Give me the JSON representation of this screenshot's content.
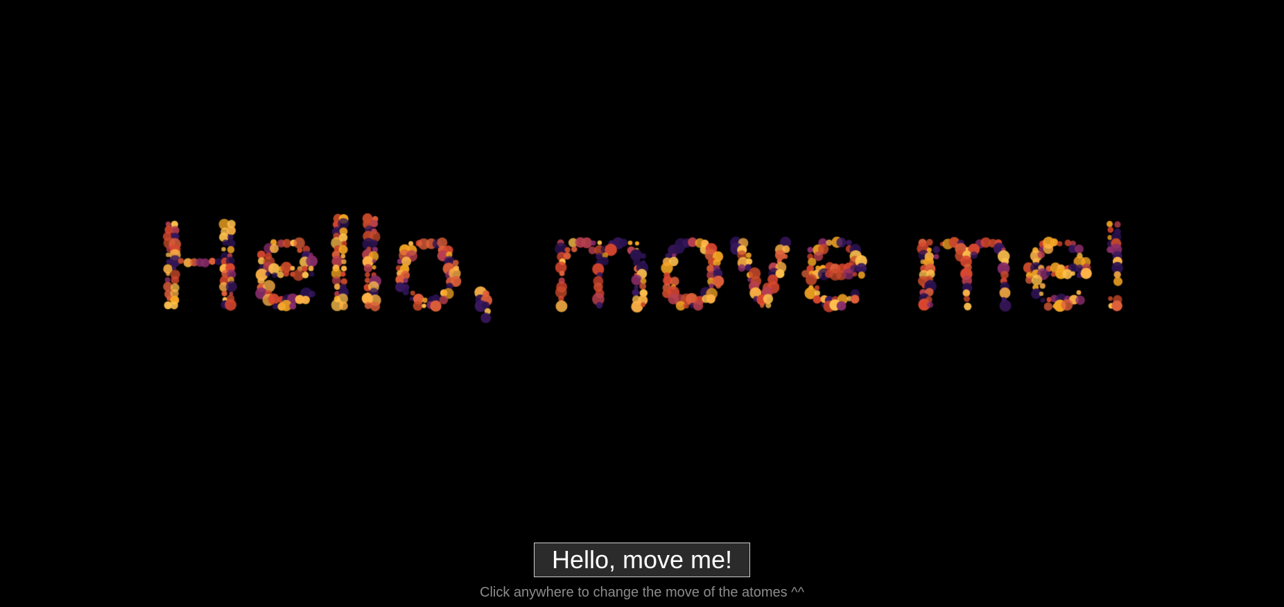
{
  "canvas": {
    "text": "Hello, move me!",
    "background": "#000000",
    "palette": [
      "#ffb347",
      "#f5a623",
      "#e0603a",
      "#c94a2a",
      "#b8404f",
      "#8a2d6b",
      "#3a1860",
      "#2a1250",
      "#d9472f",
      "#ffc14d"
    ]
  },
  "input": {
    "value": "Hello, move me!"
  },
  "hint": {
    "text": "Click anywhere to change the move of the atomes ^^"
  }
}
